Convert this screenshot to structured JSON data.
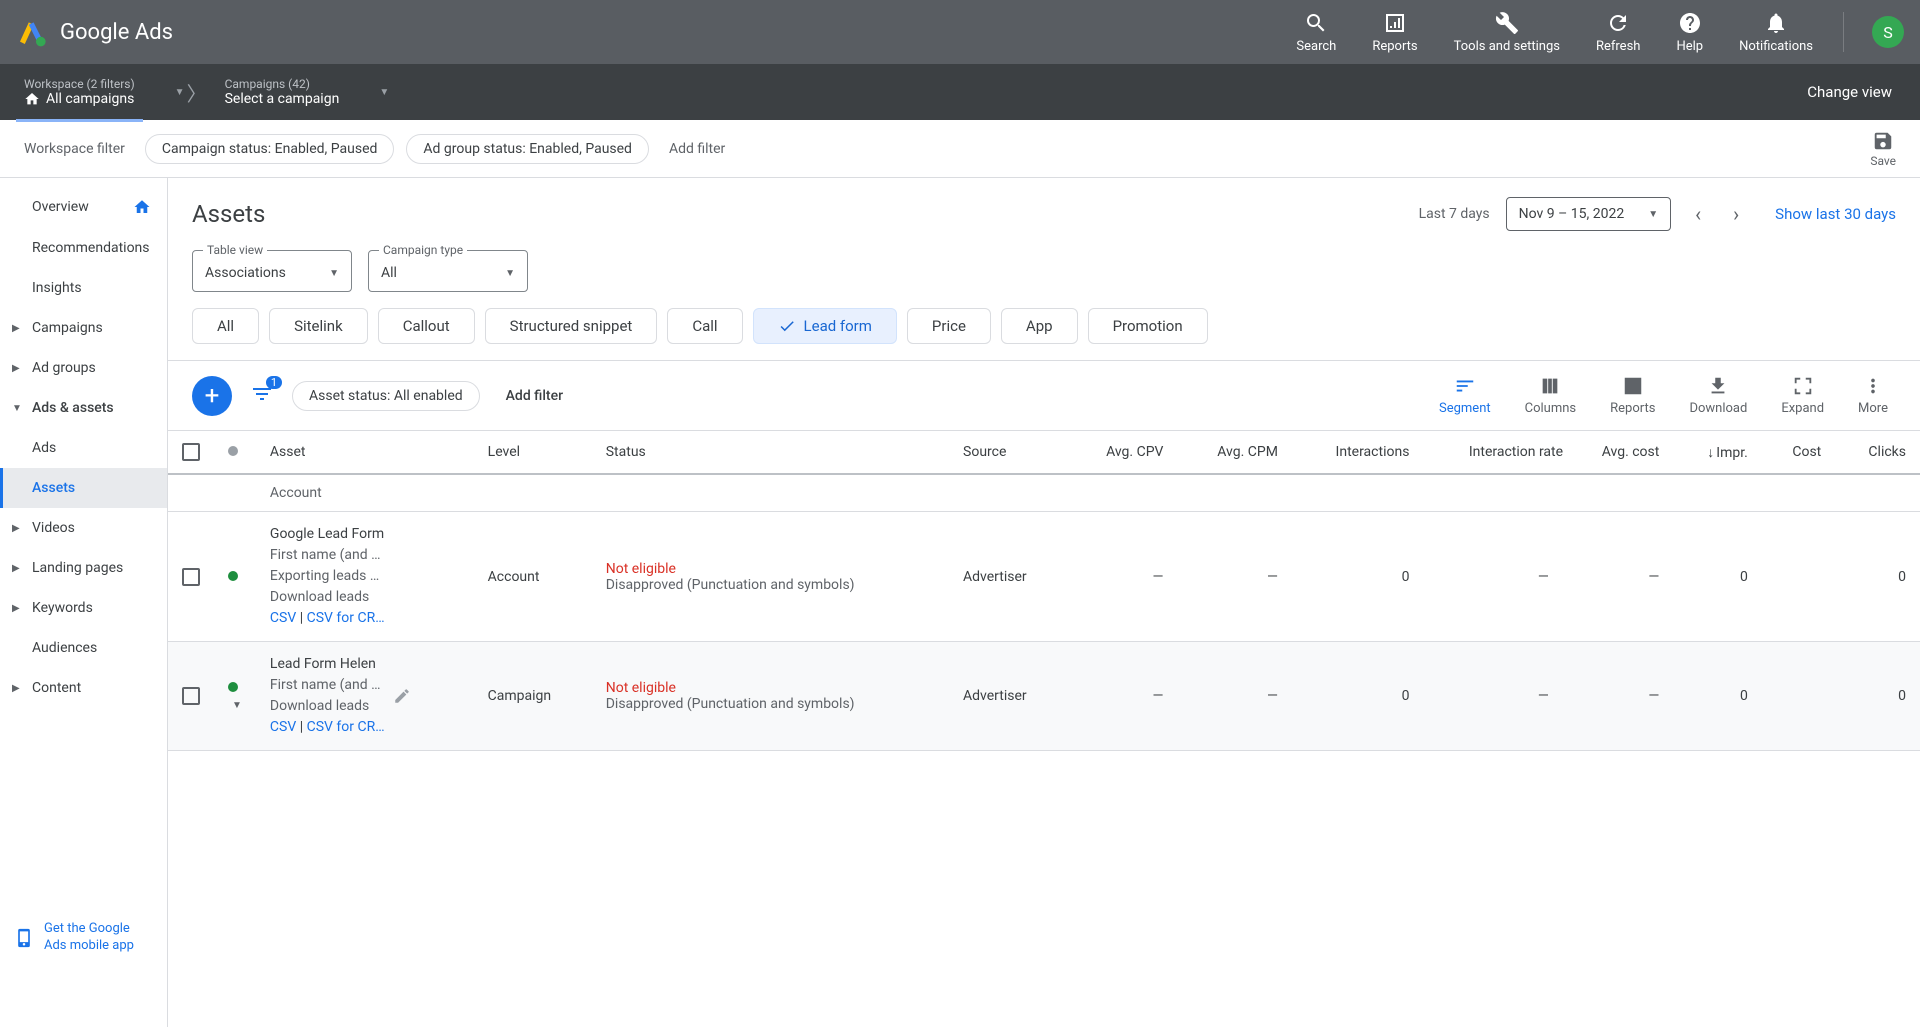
{
  "brand": "Google Ads",
  "avatar_initial": "S",
  "top_actions": {
    "search": "Search",
    "reports": "Reports",
    "tools": "Tools and settings",
    "refresh": "Refresh",
    "help": "Help",
    "notifications": "Notifications"
  },
  "nav": {
    "workspace_top": "Workspace (2 filters)",
    "workspace_bottom": "All campaigns",
    "campaigns_top": "Campaigns (42)",
    "campaigns_bottom": "Select a campaign",
    "change_view": "Change view"
  },
  "filterbar": {
    "label": "Workspace filter",
    "chip1": "Campaign status: Enabled, Paused",
    "chip2": "Ad group status: Enabled, Paused",
    "add": "Add filter",
    "save": "Save"
  },
  "sidebar": {
    "overview": "Overview",
    "recommendations": "Recommendations",
    "insights": "Insights",
    "campaigns": "Campaigns",
    "ad_groups": "Ad groups",
    "ads_assets": "Ads & assets",
    "ads": "Ads",
    "assets": "Assets",
    "videos": "Videos",
    "landing_pages": "Landing pages",
    "keywords": "Keywords",
    "audiences": "Audiences",
    "content": "Content"
  },
  "header": {
    "title": "Assets",
    "last7": "Last 7 days",
    "date_range": "Nov 9 – 15, 2022",
    "show30": "Show last 30 days"
  },
  "selects": {
    "table_view_label": "Table view",
    "table_view_value": "Associations",
    "campaign_type_label": "Campaign type",
    "campaign_type_value": "All"
  },
  "tabs": {
    "all": "All",
    "sitelink": "Sitelink",
    "callout": "Callout",
    "snippet": "Structured snippet",
    "call": "Call",
    "leadform": "Lead form",
    "price": "Price",
    "app": "App",
    "promotion": "Promotion"
  },
  "toolbar": {
    "asset_status_chip": "Asset status: All enabled",
    "add_filter": "Add filter",
    "filter_badge": "1",
    "segment": "Segment",
    "columns": "Columns",
    "reports": "Reports",
    "download": "Download",
    "expand": "Expand",
    "more": "More"
  },
  "table": {
    "headers": {
      "asset": "Asset",
      "level": "Level",
      "status": "Status",
      "source": "Source",
      "avg_cpv": "Avg. CPV",
      "avg_cpm": "Avg. CPM",
      "interactions": "Interactions",
      "interaction_rate": "Interaction rate",
      "avg_cost": "Avg. cost",
      "impr": "Impr.",
      "cost": "Cost",
      "clicks": "Clicks"
    },
    "group_label": "Account",
    "rows": [
      {
        "title": "Google Lead Form",
        "subtitle": "First name (and …",
        "export_line": "Exporting leads …",
        "download_label": "Download leads",
        "csv": "CSV",
        "csv_crm": "CSV for CR…",
        "level": "Account",
        "status_red": "Not eligible",
        "status_sub": "Disapproved (Punctuation and symbols)",
        "source": "Advertiser",
        "avg_cpv": "—",
        "avg_cpm": "—",
        "interactions": "0",
        "interaction_rate": "—",
        "avg_cost": "—",
        "impr": "0",
        "cost": "",
        "clicks": "0"
      },
      {
        "title": "Lead Form Helen",
        "subtitle": "First name (and …",
        "export_line": "",
        "download_label": "Download leads",
        "csv": "CSV",
        "csv_crm": "CSV for CR…",
        "level": "Campaign",
        "status_red": "Not eligible",
        "status_sub": "Disapproved (Punctuation and symbols)",
        "source": "Advertiser",
        "avg_cpv": "—",
        "avg_cpm": "—",
        "interactions": "0",
        "interaction_rate": "—",
        "avg_cost": "—",
        "impr": "0",
        "cost": "",
        "clicks": "0"
      }
    ]
  },
  "mobile_app": {
    "line1": "Get the Google",
    "line2": "Ads mobile app"
  }
}
